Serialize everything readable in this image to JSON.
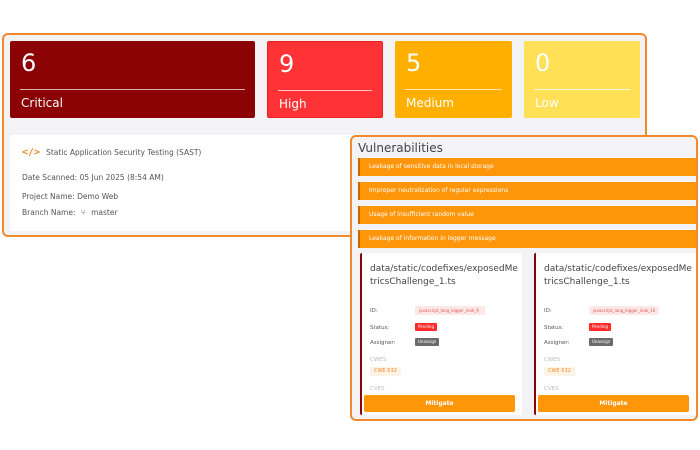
{
  "severity_cards": {
    "critical": {
      "count": "6",
      "label": "Critical",
      "color": "#8b0304"
    },
    "high": {
      "count": "9",
      "label": "High",
      "color": "#ff3335"
    },
    "medium": {
      "count": "5",
      "label": "Medium",
      "color": "#ffaf00"
    },
    "low": {
      "count": "0",
      "label": "Low",
      "color": "#ffe057"
    }
  },
  "scan": {
    "icon": "code-icon",
    "title": "Static Application Security Testing (SAST)",
    "date": "Date Scanned: 05 Jun 2025 (8:54 AM)",
    "project": "Project Name: Demo Web",
    "branch_label": "Branch Name:",
    "branch_icon": "git-branch-icon",
    "branch_value": "master"
  },
  "vulnerabilities": {
    "title": "Vulnerabilities",
    "items": [
      "Leakage of sensitive data in local storage",
      "Improper neutralization of regular expressions",
      "Usage of insufficient random value",
      "Leakage of information in logger message"
    ],
    "cards": [
      {
        "path": "data/static/codefixes/exposedMetricsChallenge_1.ts",
        "id_label": "ID:",
        "id_value": "javascript_lang_logger_leak_9",
        "status_label": "Status:",
        "status_value": "Pending",
        "assigner_label": "Assigner:",
        "assigner_value": "Unassign",
        "cwes_label": "CWES",
        "cwe": "CWE-532",
        "cves_label": "CVES",
        "action": "Mitigate"
      },
      {
        "path": "data/static/codefixes/exposedMetricsChallenge_1.ts",
        "id_label": "ID:",
        "id_value": "javascript_lang_logger_leak_10",
        "status_label": "Status:",
        "status_value": "Pending",
        "assigner_label": "Assigner:",
        "assigner_value": "Unassign",
        "cwes_label": "CWES",
        "cwe": "CWE-532",
        "cves_label": "CVES",
        "action": "Mitigate"
      }
    ]
  },
  "colors": {
    "accent": "#f08a2c",
    "bar": "#ff960a",
    "pending": "#ff2a2a"
  }
}
